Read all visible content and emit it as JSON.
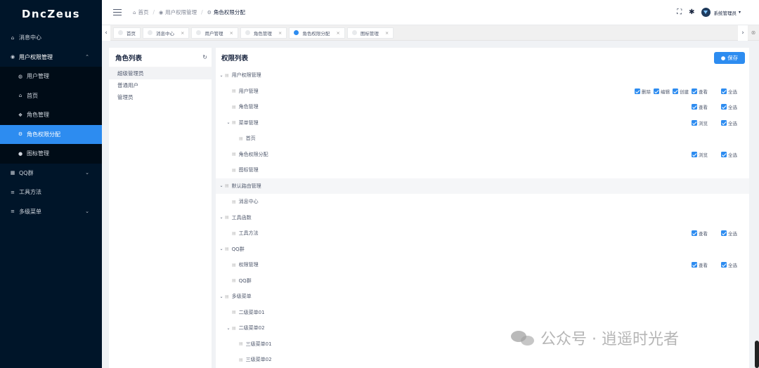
{
  "app": {
    "logo": "DncZeus"
  },
  "sidebar": {
    "items": [
      {
        "label": "消息中心",
        "icon": "home-icon"
      },
      {
        "label": "用户权限管理",
        "icon": "bag-icon",
        "open": true,
        "children": [
          {
            "label": "用户管理",
            "icon": "user-circle-icon"
          },
          {
            "label": "首页",
            "icon": "home-icon"
          },
          {
            "label": "角色管理",
            "icon": "group-icon"
          },
          {
            "label": "角色权限分配",
            "icon": "gear-icon",
            "active": true
          },
          {
            "label": "图标管理",
            "icon": "dot-icon"
          }
        ]
      },
      {
        "label": "QQ群",
        "icon": "grid-icon"
      },
      {
        "label": "工具方法",
        "icon": "list-icon"
      },
      {
        "label": "多级菜单",
        "icon": "list-icon"
      }
    ]
  },
  "header": {
    "breadcrumb": [
      "首页",
      "用户权限管理",
      "角色权限分配"
    ],
    "user_name": "系统管理员"
  },
  "tags": [
    {
      "label": "首页",
      "closable": false
    },
    {
      "label": "消息中心",
      "closable": true
    },
    {
      "label": "用户管理",
      "closable": true
    },
    {
      "label": "角色管理",
      "closable": true
    },
    {
      "label": "角色权限分配",
      "closable": true,
      "active": true
    },
    {
      "label": "图标管理",
      "closable": true
    }
  ],
  "left_panel": {
    "title": "角色列表",
    "roles": [
      "超级管理员",
      "普通用户",
      "管理员"
    ]
  },
  "right_panel": {
    "title": "权限列表",
    "save_label": "保存",
    "tree": [
      {
        "label": "用户权限管理",
        "level": 0,
        "expand": true,
        "perms": []
      },
      {
        "label": "用户管理",
        "level": 1,
        "perms": [
          "删除",
          "编辑",
          "创建",
          "查看",
          "全选"
        ]
      },
      {
        "label": "角色管理",
        "level": 1,
        "perms": [
          "查看",
          "全选"
        ]
      },
      {
        "label": "菜单管理",
        "level": 1,
        "expand": true,
        "perms": [
          "浏览",
          "全选"
        ]
      },
      {
        "label": "首页",
        "level": 2,
        "perms": []
      },
      {
        "label": "角色权限分配",
        "level": 1,
        "perms": [
          "浏览",
          "全选"
        ]
      },
      {
        "label": "图标管理",
        "level": 1,
        "perms": []
      },
      {
        "label": "默认路由管理",
        "level": 0,
        "expand": true,
        "highlight": true,
        "perms": []
      },
      {
        "label": "消息中心",
        "level": 1,
        "perms": []
      },
      {
        "label": "工具函数",
        "level": 0,
        "expand": true,
        "perms": []
      },
      {
        "label": "工具方法",
        "level": 1,
        "perms": [
          "查看",
          "全选"
        ]
      },
      {
        "label": "QQ群",
        "level": 0,
        "expand": true,
        "perms": []
      },
      {
        "label": "权限管理",
        "level": 1,
        "perms": [
          "查看",
          "全选"
        ]
      },
      {
        "label": "QQ群",
        "level": 1,
        "perms": []
      },
      {
        "label": "多级菜单",
        "level": 0,
        "expand": true,
        "perms": []
      },
      {
        "label": "二级菜单01",
        "level": 1,
        "perms": []
      },
      {
        "label": "二级菜单02",
        "level": 1,
        "expand": true,
        "perms": []
      },
      {
        "label": "三级菜单01",
        "level": 2,
        "perms": []
      },
      {
        "label": "三级菜单02",
        "level": 2,
        "perms": []
      }
    ]
  },
  "watermark": {
    "text": "公众号 · 逍遥时光者"
  }
}
